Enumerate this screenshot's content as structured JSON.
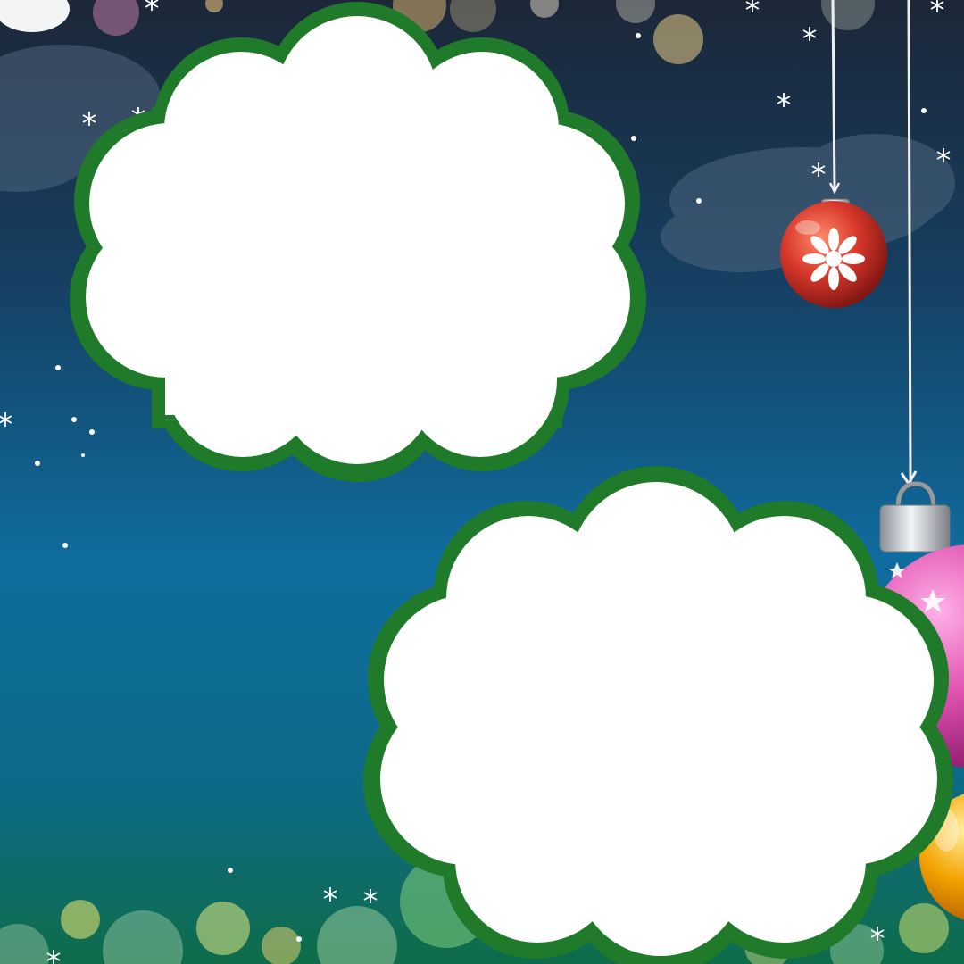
{
  "scene": {
    "theme": "christmas-night",
    "frames": [
      {
        "name": "upper-left-cloud-frame",
        "content": ""
      },
      {
        "name": "lower-right-cloud-frame",
        "content": ""
      }
    ],
    "ornaments": [
      "red-snowflake-ornament-icon",
      "pink-star-ornament-icon",
      "orange-ornament-icon"
    ],
    "colors": {
      "sky_top": "#1c2738",
      "sky_mid": "#0f5a90",
      "sky_bottom": "#0c6b4a",
      "frame_fill": "#ffffff",
      "frame_border": "#1f7a2a",
      "ornament_red": "#d8382b",
      "ornament_pink": "#e050b0",
      "ornament_orange": "#f4a300"
    }
  }
}
